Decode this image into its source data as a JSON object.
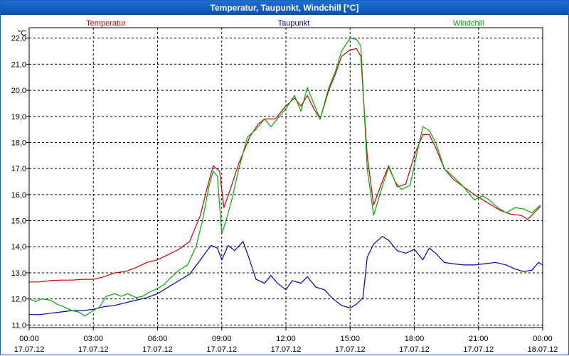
{
  "window": {
    "title": "Temperatur, Taupunkt, Windchill [°C]"
  },
  "colors": {
    "temperatur": "#cc0000",
    "taupunkt": "#0000bb",
    "windchill": "#00aa00",
    "grid": "#000000"
  },
  "chart_data": {
    "type": "line",
    "title": "Temperatur, Taupunkt, Windchill [°C]",
    "ylabel": "°C",
    "ylim": [
      10.9,
      22.4
    ],
    "y_ticks": [
      "22,0",
      "21,0",
      "20,0",
      "19,0",
      "18,0",
      "17,0",
      "16,0",
      "15,0",
      "14,0",
      "13,0",
      "12,0",
      "11,0"
    ],
    "y_tick_values": [
      22,
      21,
      20,
      19,
      18,
      17,
      16,
      15,
      14,
      13,
      12,
      11
    ],
    "x_ticks": [
      {
        "time": "00:00",
        "date": "17.07.12",
        "h": 0
      },
      {
        "time": "03:00",
        "date": "17.07.12",
        "h": 3
      },
      {
        "time": "06:00",
        "date": "17.07.12",
        "h": 6
      },
      {
        "time": "09:00",
        "date": "17.07.12",
        "h": 9
      },
      {
        "time": "12:00",
        "date": "17.07.12",
        "h": 12
      },
      {
        "time": "15:00",
        "date": "17.07.12",
        "h": 15
      },
      {
        "time": "18:00",
        "date": "17.07.12",
        "h": 18
      },
      {
        "time": "21:00",
        "date": "17.07.12",
        "h": 21
      },
      {
        "time": "00:00",
        "date": "18.07.12",
        "h": 24
      }
    ],
    "xlim": [
      0,
      24
    ],
    "grid": true,
    "series": [
      {
        "name": "Temperatur",
        "color": "#cc0000",
        "points": [
          [
            0.0,
            12.65
          ],
          [
            0.5,
            12.65
          ],
          [
            1.0,
            12.7
          ],
          [
            1.5,
            12.72
          ],
          [
            2.0,
            12.72
          ],
          [
            2.5,
            12.75
          ],
          [
            3.0,
            12.75
          ],
          [
            3.5,
            12.85
          ],
          [
            4.0,
            13.0
          ],
          [
            4.5,
            13.05
          ],
          [
            5.0,
            13.2
          ],
          [
            5.5,
            13.4
          ],
          [
            6.0,
            13.5
          ],
          [
            6.5,
            13.7
          ],
          [
            7.0,
            13.9
          ],
          [
            7.5,
            14.2
          ],
          [
            8.0,
            15.2
          ],
          [
            8.3,
            16.2
          ],
          [
            8.6,
            17.1
          ],
          [
            8.9,
            16.9
          ],
          [
            9.1,
            15.5
          ],
          [
            9.4,
            16.2
          ],
          [
            9.8,
            17.2
          ],
          [
            10.3,
            18.2
          ],
          [
            10.7,
            18.7
          ],
          [
            11.0,
            18.9
          ],
          [
            11.5,
            18.9
          ],
          [
            12.0,
            19.4
          ],
          [
            12.4,
            19.7
          ],
          [
            12.7,
            19.4
          ],
          [
            13.0,
            19.8
          ],
          [
            13.3,
            19.3
          ],
          [
            13.6,
            18.9
          ],
          [
            14.0,
            20.0
          ],
          [
            14.3,
            20.6
          ],
          [
            14.6,
            21.3
          ],
          [
            15.0,
            21.55
          ],
          [
            15.3,
            21.6
          ],
          [
            15.5,
            21.3
          ],
          [
            15.8,
            17.5
          ],
          [
            16.1,
            15.6
          ],
          [
            16.5,
            16.5
          ],
          [
            16.8,
            17.1
          ],
          [
            17.2,
            16.3
          ],
          [
            17.6,
            16.4
          ],
          [
            18.0,
            17.5
          ],
          [
            18.4,
            18.3
          ],
          [
            18.7,
            18.3
          ],
          [
            19.0,
            17.8
          ],
          [
            19.4,
            17.0
          ],
          [
            19.8,
            16.6
          ],
          [
            20.3,
            16.3
          ],
          [
            20.8,
            16.0
          ],
          [
            21.2,
            15.8
          ],
          [
            21.6,
            15.6
          ],
          [
            22.0,
            15.4
          ],
          [
            22.5,
            15.25
          ],
          [
            23.0,
            15.2
          ],
          [
            23.3,
            15.05
          ],
          [
            23.6,
            15.3
          ],
          [
            23.9,
            15.55
          ]
        ]
      },
      {
        "name": "Taupunkt",
        "color": "#0000bb",
        "points": [
          [
            0.0,
            11.4
          ],
          [
            0.5,
            11.4
          ],
          [
            1.0,
            11.45
          ],
          [
            1.5,
            11.5
          ],
          [
            2.0,
            11.55
          ],
          [
            2.5,
            11.55
          ],
          [
            3.0,
            11.6
          ],
          [
            3.5,
            11.7
          ],
          [
            4.0,
            11.75
          ],
          [
            4.5,
            11.85
          ],
          [
            5.0,
            11.95
          ],
          [
            5.5,
            12.05
          ],
          [
            6.0,
            12.2
          ],
          [
            6.5,
            12.45
          ],
          [
            7.0,
            12.7
          ],
          [
            7.5,
            12.95
          ],
          [
            8.0,
            13.5
          ],
          [
            8.5,
            14.05
          ],
          [
            8.8,
            13.95
          ],
          [
            9.0,
            13.5
          ],
          [
            9.3,
            14.05
          ],
          [
            9.6,
            13.85
          ],
          [
            10.0,
            14.2
          ],
          [
            10.3,
            13.5
          ],
          [
            10.6,
            12.75
          ],
          [
            11.0,
            12.6
          ],
          [
            11.3,
            12.9
          ],
          [
            11.6,
            12.6
          ],
          [
            12.0,
            12.35
          ],
          [
            12.3,
            12.7
          ],
          [
            12.7,
            12.6
          ],
          [
            13.0,
            12.85
          ],
          [
            13.4,
            12.45
          ],
          [
            13.8,
            12.35
          ],
          [
            14.2,
            12.0
          ],
          [
            14.6,
            11.75
          ],
          [
            15.0,
            11.65
          ],
          [
            15.3,
            11.8
          ],
          [
            15.6,
            12.05
          ],
          [
            15.8,
            13.6
          ],
          [
            16.1,
            14.1
          ],
          [
            16.5,
            14.4
          ],
          [
            16.8,
            14.25
          ],
          [
            17.2,
            13.85
          ],
          [
            17.6,
            13.75
          ],
          [
            18.0,
            13.9
          ],
          [
            18.4,
            13.5
          ],
          [
            18.7,
            13.95
          ],
          [
            19.0,
            13.75
          ],
          [
            19.4,
            13.4
          ],
          [
            19.8,
            13.35
          ],
          [
            20.3,
            13.3
          ],
          [
            20.8,
            13.3
          ],
          [
            21.3,
            13.35
          ],
          [
            21.8,
            13.4
          ],
          [
            22.3,
            13.3
          ],
          [
            22.7,
            13.15
          ],
          [
            23.1,
            13.05
          ],
          [
            23.5,
            13.1
          ],
          [
            23.8,
            13.4
          ],
          [
            24.0,
            13.3
          ]
        ]
      },
      {
        "name": "Windchill",
        "color": "#00aa00",
        "points": [
          [
            0.0,
            12.0
          ],
          [
            0.3,
            11.9
          ],
          [
            0.6,
            12.0
          ],
          [
            1.0,
            11.95
          ],
          [
            1.3,
            11.8
          ],
          [
            1.6,
            11.7
          ],
          [
            2.0,
            11.55
          ],
          [
            2.3,
            11.5
          ],
          [
            2.6,
            11.35
          ],
          [
            3.0,
            11.55
          ],
          [
            3.3,
            11.7
          ],
          [
            3.6,
            12.1
          ],
          [
            4.0,
            12.2
          ],
          [
            4.3,
            12.1
          ],
          [
            4.6,
            12.2
          ],
          [
            5.0,
            12.05
          ],
          [
            5.3,
            12.1
          ],
          [
            5.6,
            12.25
          ],
          [
            6.0,
            12.4
          ],
          [
            6.3,
            12.55
          ],
          [
            6.6,
            12.8
          ],
          [
            7.0,
            13.1
          ],
          [
            7.4,
            13.3
          ],
          [
            7.8,
            14.0
          ],
          [
            8.1,
            15.0
          ],
          [
            8.4,
            16.3
          ],
          [
            8.6,
            16.9
          ],
          [
            8.8,
            16.7
          ],
          [
            9.0,
            14.5
          ],
          [
            9.2,
            15.0
          ],
          [
            9.5,
            15.9
          ],
          [
            9.8,
            17.0
          ],
          [
            10.2,
            18.2
          ],
          [
            10.6,
            18.5
          ],
          [
            11.0,
            18.9
          ],
          [
            11.3,
            18.6
          ],
          [
            11.6,
            18.9
          ],
          [
            12.0,
            19.3
          ],
          [
            12.4,
            19.8
          ],
          [
            12.7,
            19.2
          ],
          [
            13.0,
            20.1
          ],
          [
            13.3,
            19.5
          ],
          [
            13.6,
            18.9
          ],
          [
            14.0,
            20.1
          ],
          [
            14.3,
            20.7
          ],
          [
            14.6,
            21.5
          ],
          [
            15.0,
            22.0
          ],
          [
            15.3,
            21.95
          ],
          [
            15.5,
            21.7
          ],
          [
            15.8,
            17.0
          ],
          [
            16.1,
            15.2
          ],
          [
            16.5,
            16.3
          ],
          [
            16.8,
            17.05
          ],
          [
            17.1,
            16.5
          ],
          [
            17.4,
            16.2
          ],
          [
            17.8,
            16.35
          ],
          [
            18.1,
            17.5
          ],
          [
            18.4,
            18.6
          ],
          [
            18.7,
            18.45
          ],
          [
            19.0,
            18.0
          ],
          [
            19.4,
            17.0
          ],
          [
            19.8,
            16.7
          ],
          [
            20.3,
            16.3
          ],
          [
            20.8,
            15.8
          ],
          [
            21.2,
            15.95
          ],
          [
            21.5,
            15.8
          ],
          [
            21.9,
            15.5
          ],
          [
            22.3,
            15.3
          ],
          [
            22.7,
            15.5
          ],
          [
            23.1,
            15.45
          ],
          [
            23.5,
            15.3
          ],
          [
            23.9,
            15.6
          ]
        ]
      }
    ]
  }
}
